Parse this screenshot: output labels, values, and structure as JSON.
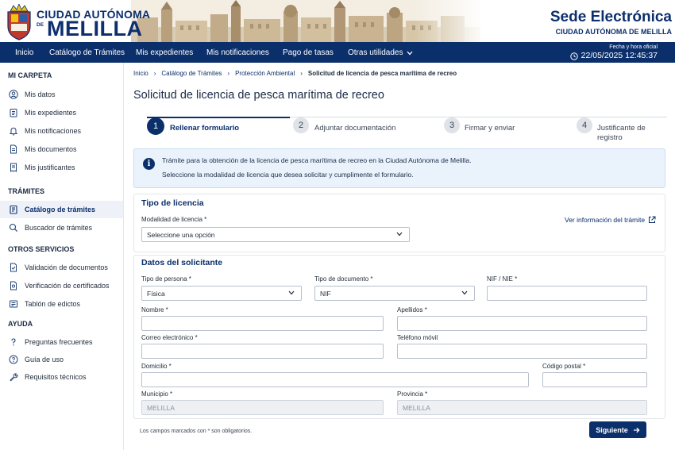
{
  "header": {
    "logo_line1": "CIUDAD AUTÓNOMA",
    "logo_de": "DE",
    "logo_line2": "MELILLA",
    "site_title": "Sede Electrónica",
    "site_subtitle": "CIUDAD AUTÓNOMA DE MELILLA"
  },
  "nav": {
    "items": [
      "Inicio",
      "Catálogo de Trámites",
      "Mis expedientes",
      "Mis notificaciones",
      "Pago de tasas",
      "Otras utilidades"
    ],
    "clock_label": "Fecha y hora oficial",
    "clock_value": "22/05/2025 12:45:37"
  },
  "sidebar": {
    "sections": [
      {
        "title": "MI CARPETA",
        "items": [
          {
            "label": "Mis datos",
            "icon": "user-circle-icon"
          },
          {
            "label": "Mis expedientes",
            "icon": "clipboard-icon"
          },
          {
            "label": "Mis notificaciones",
            "icon": "bell-icon"
          },
          {
            "label": "Mis documentos",
            "icon": "document-icon"
          },
          {
            "label": "Mis justificantes",
            "icon": "receipt-icon"
          }
        ]
      },
      {
        "title": "TRÁMITES",
        "items": [
          {
            "label": "Catálogo de trámites",
            "icon": "catalog-icon",
            "active": true
          },
          {
            "label": "Buscador de trámites",
            "icon": "search-icon"
          }
        ]
      },
      {
        "title": "OTROS SERVICIOS",
        "items": [
          {
            "label": "Validación de documentos",
            "icon": "document-check-icon"
          },
          {
            "label": "Verificación de certificados",
            "icon": "certificate-icon"
          },
          {
            "label": "Tablón de edictos",
            "icon": "bulletin-icon"
          }
        ]
      },
      {
        "title": "AYUDA",
        "items": [
          {
            "label": "Preguntas frecuentes",
            "icon": "question-icon"
          },
          {
            "label": "Guía de uso",
            "icon": "help-circle-icon"
          },
          {
            "label": "Requisitos técnicos",
            "icon": "wrench-icon"
          }
        ]
      }
    ]
  },
  "breadcrumb": [
    "Inicio",
    "Catálogo de Trámites",
    "Protección Ambiental",
    "Solicitud de licencia de pesca marítima de recreo"
  ],
  "page_title": "Solicitud de licencia de pesca marítima de recreo",
  "stepper": {
    "steps": [
      {
        "number": "1",
        "label": "Rellenar formulario"
      },
      {
        "number": "2",
        "label": "Adjuntar documentación"
      },
      {
        "number": "3",
        "label": "Firmar y enviar"
      },
      {
        "number": "4",
        "label": "Justificante de registro"
      }
    ],
    "active_step": 1
  },
  "info": {
    "line1": "Trámite para la obtención de la licencia de pesca marítima de recreo en la Ciudad Autónoma de Melilla.",
    "line2": "Seleccione la modalidad de licencia que desea solicitar y cumplimente el formulario."
  },
  "license_type": {
    "title": "Tipo de licencia",
    "modalidad_label": "Modalidad de licencia *",
    "modalidad_value": "Seleccione una opción",
    "info_link": "Ver información del trámite"
  },
  "applicant": {
    "title": "Datos del solicitante",
    "tipo_persona_label": "Tipo de persona *",
    "tipo_persona_value": "Física",
    "tipo_documento_label": "Tipo de documento *",
    "tipo_documento_value": "NIF",
    "nif_label": "NIF / NIE *",
    "nif_value": "",
    "nombre_label": "Nombre *",
    "nombre_value": "",
    "apellidos_label": "Apellidos *",
    "apellidos_value": "",
    "correo_label": "Correo electrónico *",
    "correo_value": "",
    "telefono_label": "Teléfono móvil",
    "telefono_value": "",
    "domicilio_label": "Domicilio *",
    "domicilio_value": "",
    "cp_label": "Código postal *",
    "cp_value": "",
    "municipio_label": "Municipio *",
    "municipio_value": "MELILLA",
    "provincia_label": "Provincia *",
    "provincia_value": "MELILLA"
  },
  "footer": {
    "required_note": "Los campos marcados con * son obligatorios.",
    "next_button": "Siguiente"
  },
  "colors": {
    "primary": "#0b2f6b",
    "info_bg": "#eaf3fc",
    "active_sidebar_bg": "#eef2f8"
  }
}
